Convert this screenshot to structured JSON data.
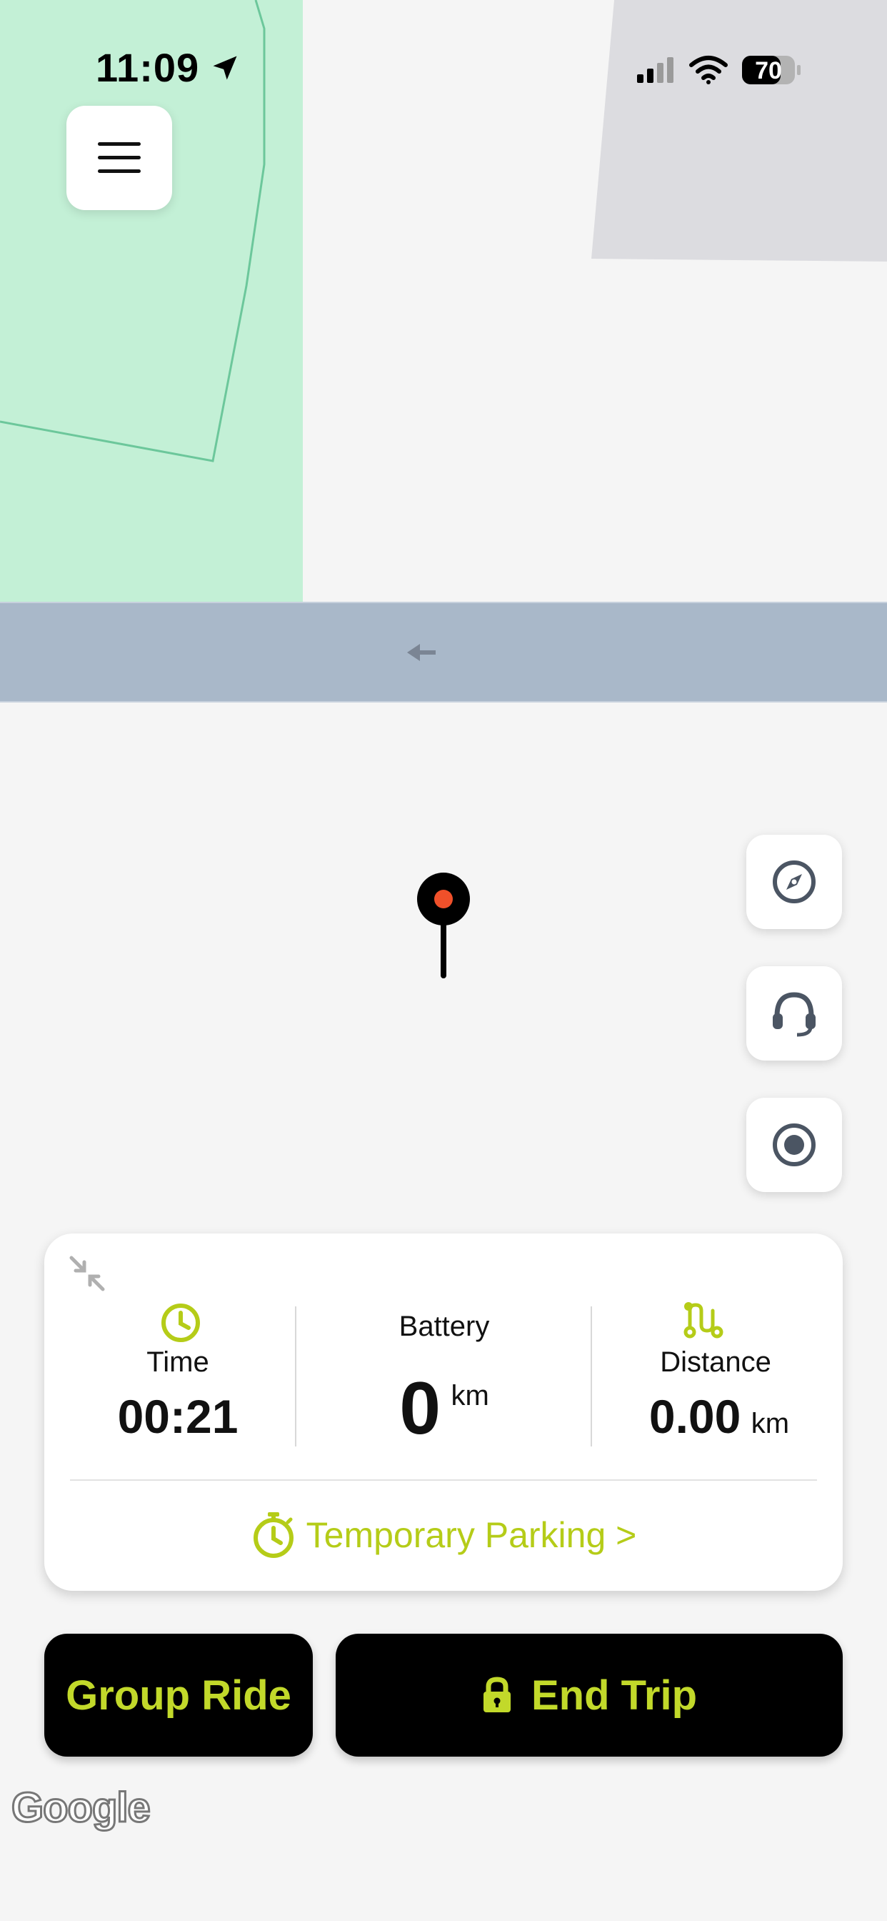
{
  "status_bar": {
    "time": "11:09",
    "battery": "70"
  },
  "map": {
    "attribution": "Google"
  },
  "trip_card": {
    "time_label": "Time",
    "time_value": "00:21",
    "battery_label": "Battery",
    "battery_value": "0",
    "battery_unit": "km",
    "distance_label": "Distance",
    "distance_value": "0.00",
    "distance_unit": "km",
    "parking_link": "Temporary Parking >"
  },
  "actions": {
    "group_ride": "Group Ride",
    "end_trip": "End Trip"
  },
  "colors": {
    "accent": "#b5cc18",
    "park": "#c3f0d6",
    "road": "#a9b8c9",
    "building": "#dcdce0",
    "pin_dot": "#f0502a"
  }
}
